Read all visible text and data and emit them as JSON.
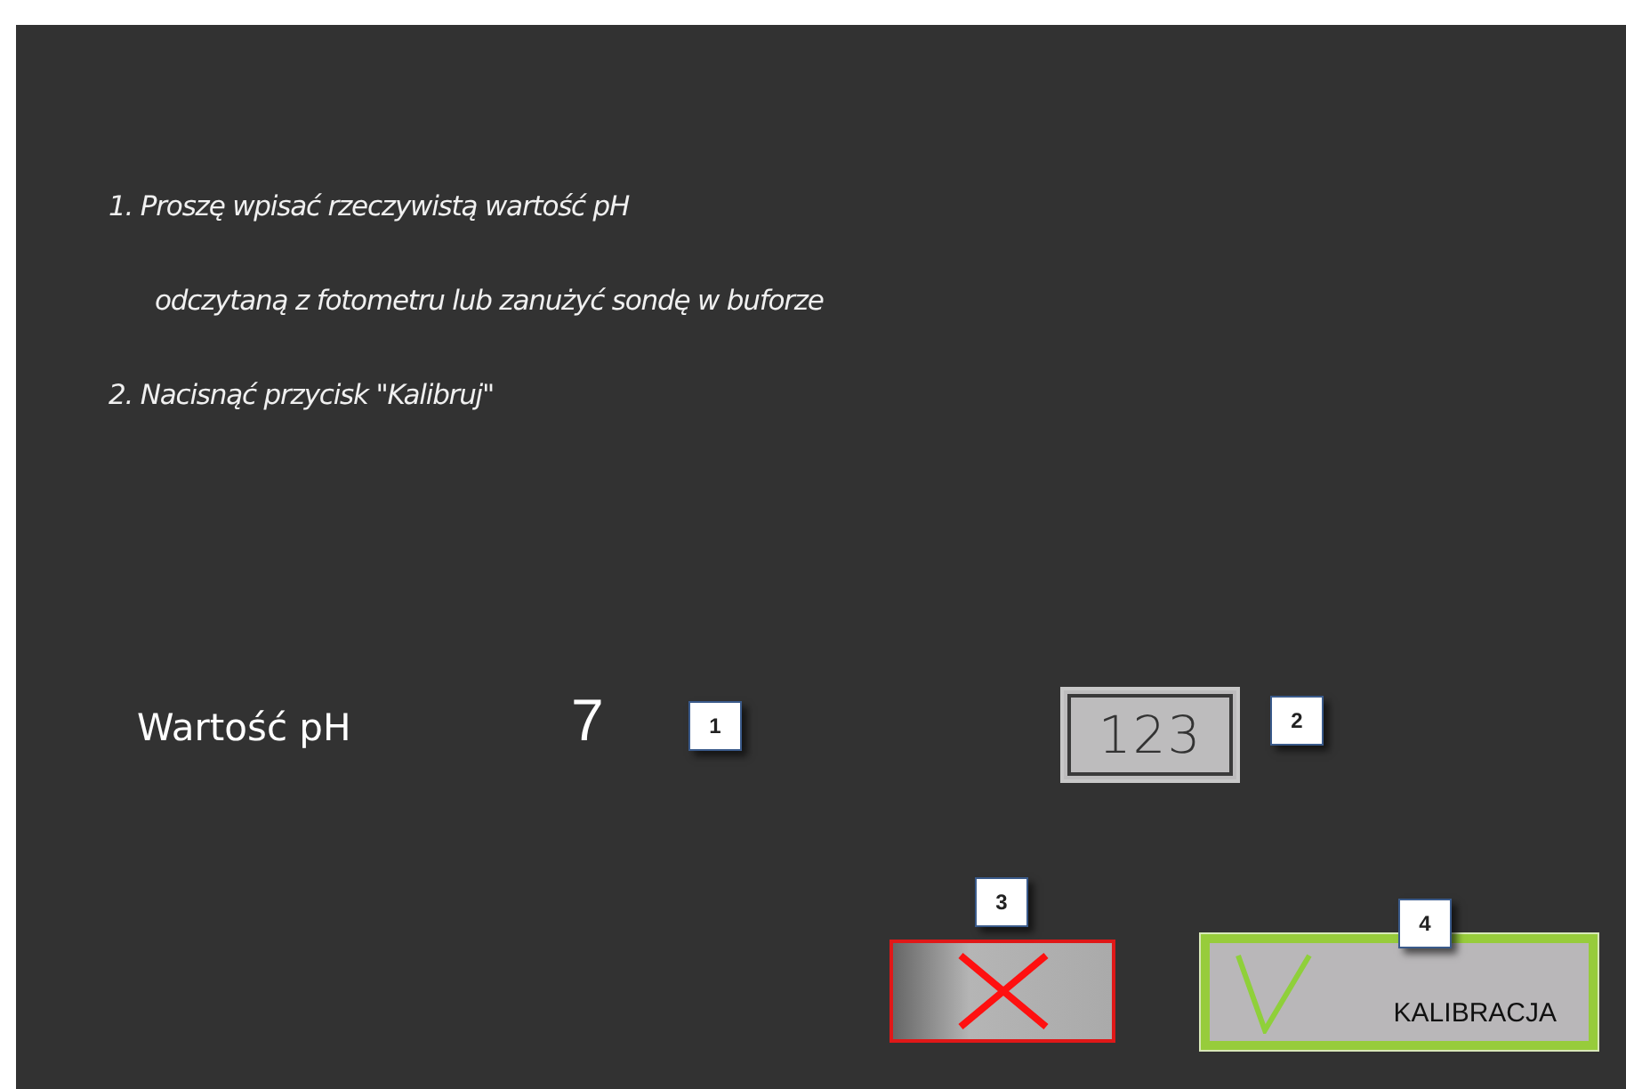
{
  "instructions": [
    "1. Proszę wpisać rzeczywistą wartość pH",
    "odczytaną z fotometru lub zanużyć sondę w buforze",
    "2. Nacisnąć przycisk \"Kalibruj\""
  ],
  "ph": {
    "label": "Wartość pH",
    "value": "7",
    "callout": "1"
  },
  "keypad_button": {
    "label": "123",
    "callout": "2"
  },
  "cancel_button": {
    "callout": "3"
  },
  "calibrate_button": {
    "label": "KALIBRACJA",
    "callout": "4"
  }
}
